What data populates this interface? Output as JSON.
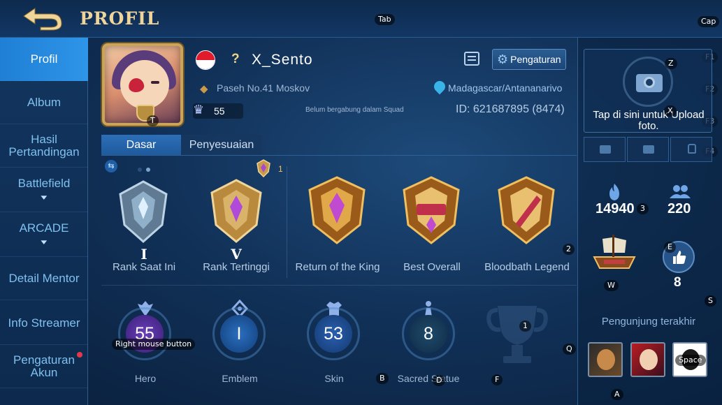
{
  "header": {
    "title": "PROFIL",
    "back_icon": "back-arrow-icon"
  },
  "key_hints": {
    "tab": "Tab",
    "cap": "Cap",
    "f1": "F1",
    "f2": "F2",
    "f3": "F3",
    "f4": "F4",
    "z": "Z",
    "x": "X",
    "three": "3",
    "e": "E",
    "w": "W",
    "s": "S",
    "two": "2",
    "one": "1",
    "q": "Q",
    "b": "B",
    "d": "D",
    "f": "F",
    "a": "A",
    "t": "T",
    "rmb": "Right mouse button",
    "space": "Space"
  },
  "sidebar": {
    "items": [
      {
        "label": "Profil",
        "active": true
      },
      {
        "label": "Album"
      },
      {
        "label": "Hasil Pertandingan"
      },
      {
        "label": "Battlefield",
        "chevron": "chevron-down-icon"
      },
      {
        "label": "ARCADE",
        "chevron": "chevron-down-icon"
      },
      {
        "label": "Detail Mentor"
      },
      {
        "label": "Info Streamer"
      },
      {
        "label": "Pengaturan Akun",
        "notification": true
      }
    ]
  },
  "profile": {
    "username": "X_Sento",
    "prefix": "?",
    "squad_name": "Paseh No.41 Moskov",
    "level": "55",
    "squad_status": "Belum bergabung dalam Squad",
    "location": "Madagascar/Antananarivo",
    "id": "ID: 621687895 (8474)",
    "settings_label": "Pengaturan",
    "flag": "indonesia-flag-icon"
  },
  "tabs": [
    {
      "label": "Dasar",
      "active": true
    },
    {
      "label": "Penyesuaian"
    }
  ],
  "ranks": {
    "mini_count": "1",
    "items": [
      {
        "label": "Rank Saat Ini",
        "roman": "I"
      },
      {
        "label": "Rank Tertinggi",
        "roman": "V"
      },
      {
        "label": "Return of the King"
      },
      {
        "label": "Best Overall"
      },
      {
        "label": "Bloodbath Legend"
      }
    ]
  },
  "stats": [
    {
      "label": "Hero",
      "value": "55"
    },
    {
      "label": "Emblem",
      "value": "I"
    },
    {
      "label": "Skin",
      "value": "53"
    },
    {
      "label": "Sacred Statue",
      "value": "8"
    }
  ],
  "right_panel": {
    "upload_text": "Tap di sini untuk Upload foto.",
    "popularity": "14940",
    "followers": "220",
    "likes": "8",
    "visitors_title": "Pengunjung terakhir"
  },
  "colors": {
    "accent": "#2e95e8",
    "gold": "#f0d59a",
    "panel": "#113158"
  }
}
